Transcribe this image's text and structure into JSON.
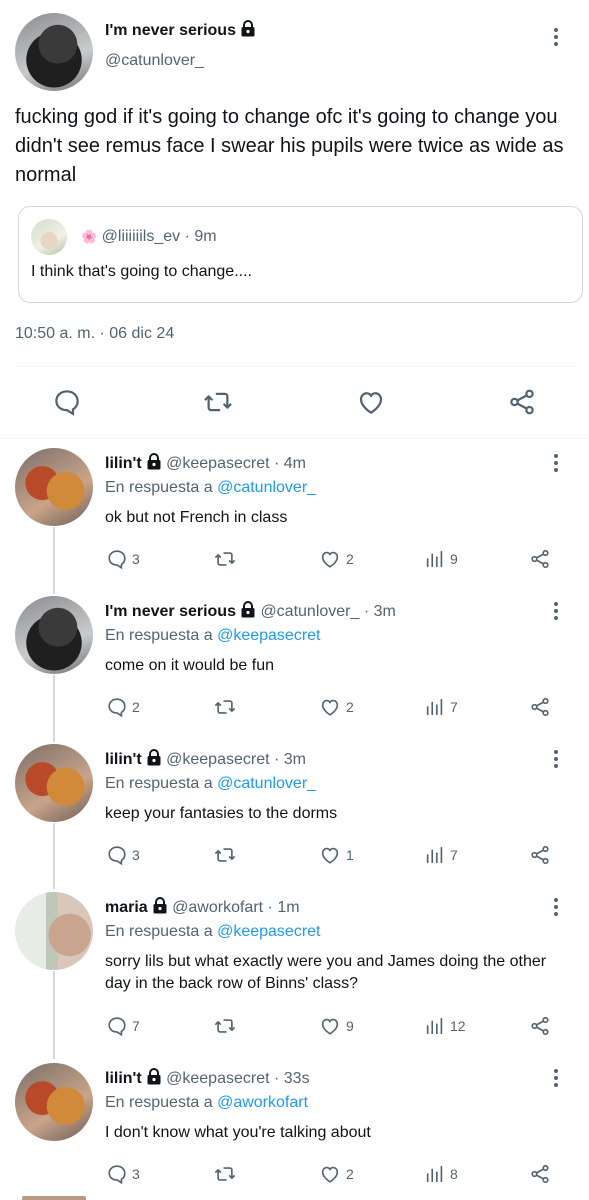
{
  "main_tweet": {
    "display_name": "I'm never serious",
    "handle": "@catunlover_",
    "text": "fucking god if it's going to change ofc it's going to change you didn't see remus face I swear his pupils were twice as wide as normal",
    "quote": {
      "emoji": "🌸",
      "handle": "@liiiiiils_ev",
      "separator": "·",
      "time": "9m",
      "text": "I think that's going to change...."
    },
    "timestamp": "10:50 a. m.",
    "dot": "·",
    "date": "06 dic 24"
  },
  "replies": [
    {
      "name": "lilin't",
      "handle": "@keepasecret",
      "time": "4m",
      "reply_prefix": "En respuesta a",
      "reply_to": "@catunlover_",
      "text": "ok but not French in class",
      "replies": "3",
      "likes": "2",
      "views": "9"
    },
    {
      "name": "I'm never serious",
      "handle": "@catunlover_",
      "time": "3m",
      "reply_prefix": "En respuesta a",
      "reply_to": "@keepasecret",
      "text": "come on it would be fun",
      "replies": "2",
      "likes": "2",
      "views": "7"
    },
    {
      "name": "lilin't",
      "handle": "@keepasecret",
      "time": "3m",
      "reply_prefix": "En respuesta a",
      "reply_to": "@catunlover_",
      "text": "keep your fantasies to the dorms",
      "replies": "3",
      "likes": "1",
      "views": "7"
    },
    {
      "name": "maria",
      "handle": "@aworkofart",
      "time": "1m",
      "reply_prefix": "En respuesta a",
      "reply_to": "@keepasecret",
      "text": "sorry lils but what exactly were you and James doing the other day in the back row of Binns' class?",
      "replies": "7",
      "likes": "9",
      "views": "12"
    },
    {
      "name": "lilin't",
      "handle": "@keepasecret",
      "time": "33s",
      "reply_prefix": "En respuesta a",
      "reply_to": "@aworkofart",
      "text": "I don't know what you're talking about",
      "replies": "3",
      "likes": "2",
      "views": "8"
    }
  ],
  "sep": "·",
  "colors": {
    "link": "#1d9bf0",
    "muted": "#536471",
    "text": "#0f1419",
    "border": "#cfd9de"
  }
}
